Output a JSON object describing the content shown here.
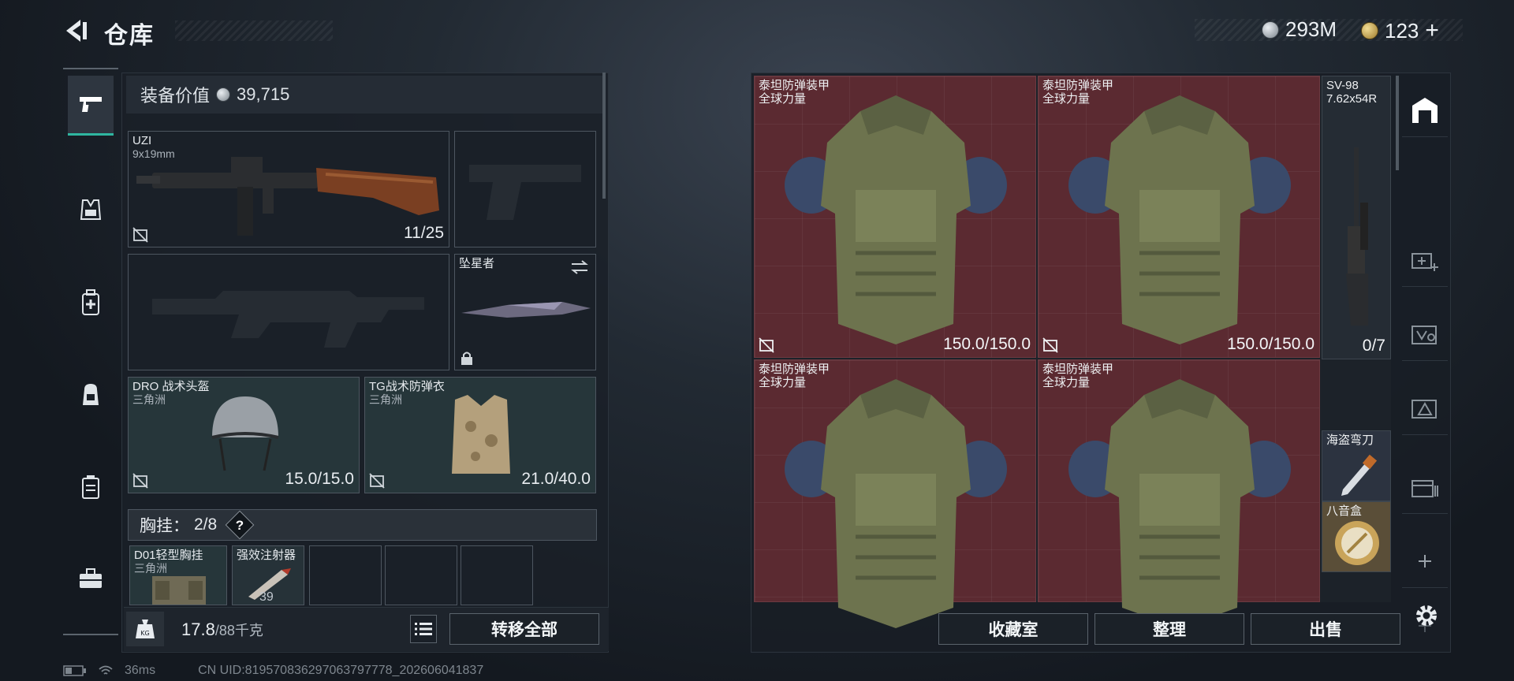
{
  "header": {
    "title": "仓库",
    "back_icon": "back-arrow-icon"
  },
  "currency": {
    "silver": "293M",
    "gold": "123",
    "gold_plus": "+"
  },
  "left": {
    "value_label": "装备价值",
    "value": "39,715",
    "weapon1": {
      "name": "UZI",
      "caliber": "9x19mm",
      "ammo": "11/25"
    },
    "melee": {
      "name": "坠星者"
    },
    "helmet": {
      "name": "DRO 战术头盔",
      "sub": "三角洲",
      "durability": "15.0/15.0"
    },
    "vest": {
      "name": "TG战术防弹衣",
      "sub": "三角洲",
      "durability": "21.0/40.0"
    },
    "rig": {
      "label": "胸挂：",
      "count": "2/8",
      "help": "?"
    },
    "rig_items": [
      {
        "name": "D01轻型胸挂",
        "sub": "三角洲"
      },
      {
        "name": "强效注射器",
        "count": "39"
      }
    ],
    "weight": "17.8",
    "weight_max": "/88千克",
    "transfer_all": "转移全部"
  },
  "storage": {
    "armor": [
      {
        "name": "泰坦防弹装甲",
        "sub": "全球力量",
        "durability": "150.0/150.0"
      },
      {
        "name": "泰坦防弹装甲",
        "sub": "全球力量",
        "durability": "150.0/150.0"
      },
      {
        "name": "泰坦防弹装甲",
        "sub": "全球力量",
        "durability": ""
      },
      {
        "name": "泰坦防弹装甲",
        "sub": "全球力量",
        "durability": ""
      }
    ],
    "sniper": {
      "name": "SV-98",
      "caliber": "7.62x54R",
      "ammo": "0/7"
    },
    "knife": {
      "name": "海盗弯刀"
    },
    "music_box": {
      "name": "八音盒"
    },
    "buttons": {
      "collection": "收藏室",
      "sort": "整理",
      "sell": "出售"
    }
  },
  "status": {
    "ping": "36ms",
    "uid": "CN UID:819570836297063797778_202606041837"
  }
}
